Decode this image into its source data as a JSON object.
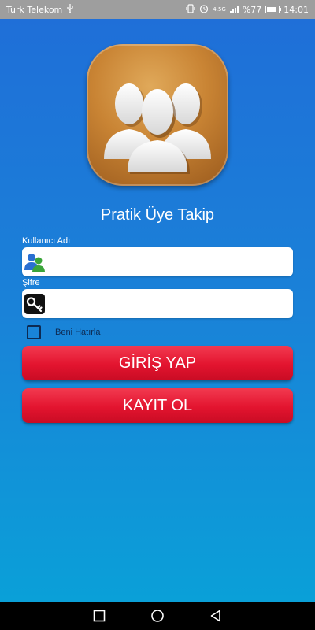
{
  "status_bar": {
    "carrier": "Turk Telekom",
    "network": "4.5G",
    "battery": "%77",
    "time": "14:01"
  },
  "app": {
    "title": "Pratik Üye Takip",
    "logo_icon": "users-group-icon"
  },
  "form": {
    "username_label": "Kullanıcı Adı",
    "username_value": "",
    "username_icon": "users-icon",
    "password_label": "Şifre",
    "password_value": "",
    "password_icon": "key-icon",
    "remember_label": "Beni Hatırla",
    "remember_checked": false
  },
  "buttons": {
    "login": "GİRİŞ YAP",
    "register": "KAYIT OL"
  },
  "colors": {
    "background_top": "#1f6fd8",
    "background_bottom": "#0aa0d8",
    "button": "#e3142f",
    "logo": "#c98434"
  },
  "nav_bar": [
    "square-icon",
    "circle-icon",
    "back-triangle-icon"
  ]
}
